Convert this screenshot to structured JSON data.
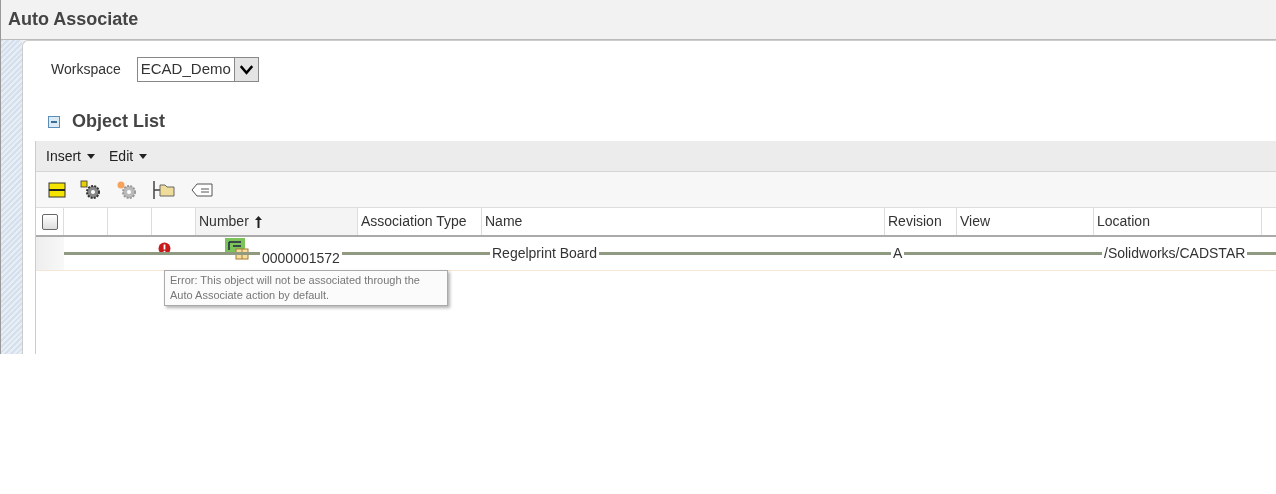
{
  "window": {
    "title": "Auto Associate"
  },
  "workspace": {
    "label": "Workspace",
    "value": "ECAD_Demo"
  },
  "section": {
    "title": "Object List",
    "expanded": true
  },
  "menus": [
    "Insert",
    "Edit"
  ],
  "table": {
    "select_all_checked": false,
    "columns": [
      {
        "label": "Number",
        "sorted": true
      },
      {
        "label": "Association Type",
        "sorted": false
      },
      {
        "label": "Name",
        "sorted": false
      },
      {
        "label": "Revision",
        "sorted": false
      },
      {
        "label": "View",
        "sorted": false
      },
      {
        "label": "Location",
        "sorted": false
      }
    ],
    "rows": [
      {
        "error": true,
        "excluded": true,
        "number": "0000001572",
        "association_type": "",
        "name": "Regelprint Board",
        "revision": "A",
        "view": "",
        "location": "/Solidworks/CADSTAR"
      }
    ]
  },
  "tooltip": "Error: This object will not be associated through the Auto Associate action by default."
}
